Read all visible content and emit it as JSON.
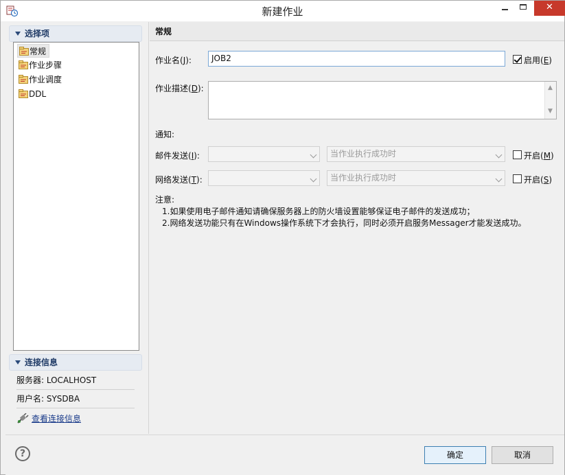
{
  "window": {
    "title": "新建作业",
    "icon": "app-icon",
    "close_glyph": "✕"
  },
  "left": {
    "select_header": "选择项",
    "nav_items": [
      {
        "label": "常规",
        "icon": "folder-icon",
        "selected": true
      },
      {
        "label": "作业步骤",
        "icon": "folder-icon",
        "selected": false
      },
      {
        "label": "作业调度",
        "icon": "folder-icon",
        "selected": false
      },
      {
        "label": "DDL",
        "icon": "folder-icon",
        "selected": false
      }
    ],
    "conn_header": "连接信息",
    "server": "服务器: LOCALHOST",
    "user": "用户名: SYSDBA",
    "view_link": "查看连接信息"
  },
  "main": {
    "header": "常规",
    "job_name_label": "作业名(",
    "job_name_key": "J",
    "job_name_label_end": "):",
    "job_name_value": "JOB2",
    "enable_label": "启用(",
    "enable_key": "E",
    "enable_label_end": ")",
    "enable_checked": true,
    "desc_label": "作业描述(",
    "desc_key": "D",
    "desc_label_end": "):",
    "notify_label": "通知:",
    "email_label": "邮件发送(",
    "email_key": "I",
    "email_label_end": "):",
    "email_condition": "当作业执行成功时",
    "email_enable": "开启(",
    "email_enable_key": "M",
    "email_enable_end": ")",
    "net_label": "网络发送(",
    "net_key": "T",
    "net_label_end": "):",
    "net_condition": "当作业执行成功时",
    "net_enable": "开启(",
    "net_enable_key": "S",
    "net_enable_end": ")",
    "note_title": "注意:",
    "note_line1": "1.如果使用电子邮件通知请确保服务器上的防火墙设置能够保证电子邮件的发送成功；",
    "note_line2": "2.网络发送功能只有在Windows操作系统下才会执行，同时必须开启服务Messager才能发送成功。"
  },
  "footer": {
    "help": "?",
    "ok": "确定",
    "cancel": "取消"
  }
}
